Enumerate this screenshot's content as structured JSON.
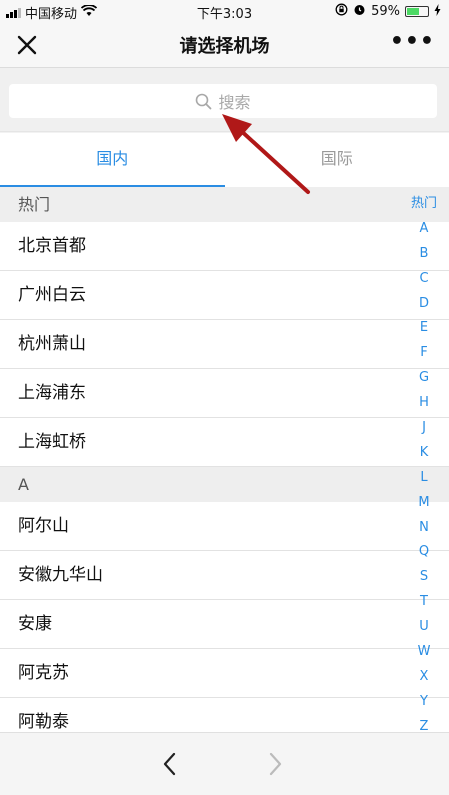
{
  "status_bar": {
    "carrier": "中国移动",
    "time": "下午3:03",
    "battery": "59%",
    "battery_level": 0.59
  },
  "nav": {
    "title": "请选择机场",
    "more": "•••"
  },
  "search": {
    "placeholder": "搜索"
  },
  "tabs": [
    {
      "label": "国内",
      "active": true
    },
    {
      "label": "国际",
      "active": false
    }
  ],
  "sections": [
    {
      "header": "热门",
      "items": [
        "北京首都",
        "广州白云",
        "杭州萧山",
        "上海浦东",
        "上海虹桥"
      ]
    },
    {
      "header": "A",
      "items": [
        "阿尔山",
        "安徽九华山",
        "安康",
        "阿克苏",
        "阿勒泰"
      ]
    }
  ],
  "index": [
    "热门",
    "A",
    "B",
    "C",
    "D",
    "E",
    "F",
    "G",
    "H",
    "J",
    "K",
    "L",
    "M",
    "N",
    "Q",
    "S",
    "T",
    "U",
    "W",
    "X",
    "Y",
    "Z"
  ],
  "colors": {
    "accent": "#2a8de3",
    "annotation_arrow": "#b01818"
  },
  "icons": {
    "close": "close-icon",
    "search": "search-icon",
    "back": "chevron-left-icon",
    "forward": "chevron-right-icon"
  }
}
